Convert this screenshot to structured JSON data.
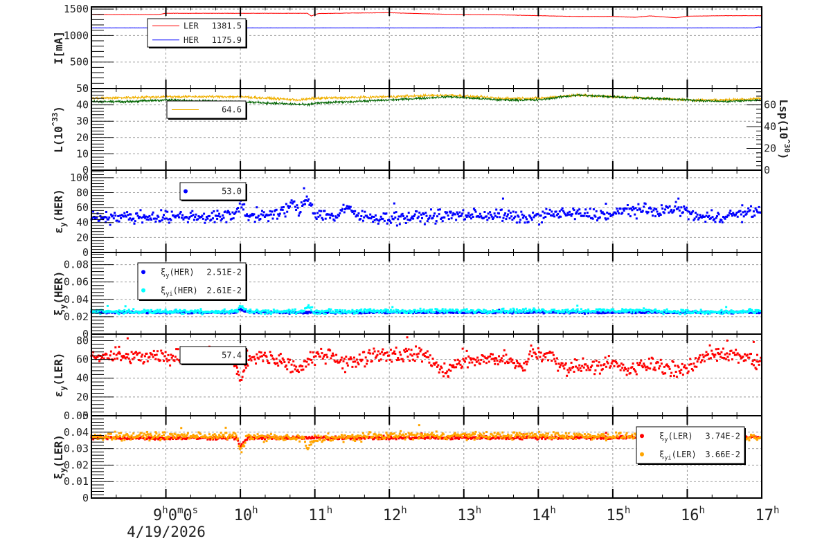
{
  "chart_data": [
    {
      "type": "line",
      "ylabel": "I[mA]",
      "ylim": [
        0,
        1540
      ],
      "yticks": [
        "0",
        "500",
        "1000",
        "1500"
      ],
      "ytick_values": [
        0,
        500,
        1000,
        1500
      ],
      "grid": true,
      "legend": {
        "placement": "top-left",
        "entries": [
          {
            "label": "LER",
            "value": "1381.5",
            "color": "#ff0000",
            "marker": "line"
          },
          {
            "label": "HER",
            "value": "1175.9",
            "color": "#0000ff",
            "marker": "line"
          }
        ]
      },
      "series": [
        {
          "name": "LER",
          "color": "#ff0000",
          "style": "line",
          "spread": 3,
          "points": [
            [
              8,
              1395
            ],
            [
              8.9,
              1395
            ],
            [
              9.0,
              1420
            ],
            [
              10,
              1420
            ],
            [
              10.9,
              1420
            ],
            [
              10.95,
              1370
            ],
            [
              11.05,
              1415
            ],
            [
              11.5,
              1425
            ],
            [
              12,
              1430
            ],
            [
              12.5,
              1410
            ],
            [
              13,
              1395
            ],
            [
              13.5,
              1390
            ],
            [
              14,
              1375
            ],
            [
              14.5,
              1360
            ],
            [
              15,
              1360
            ],
            [
              15.3,
              1345
            ],
            [
              15.5,
              1370
            ],
            [
              15.85,
              1335
            ],
            [
              16,
              1365
            ],
            [
              16.5,
              1375
            ],
            [
              17,
              1375
            ]
          ]
        },
        {
          "name": "HER",
          "color": "#0000ff",
          "style": "line",
          "spread": 2,
          "points": [
            [
              8,
              1145
            ],
            [
              9.95,
              1145
            ],
            [
              10.02,
              960
            ],
            [
              10.08,
              1145
            ],
            [
              16.9,
              1145
            ],
            [
              16.95,
              1160
            ],
            [
              17,
              1160
            ]
          ]
        }
      ]
    },
    {
      "type": "line",
      "ylabel": "L(10^33)",
      "ylim": [
        0,
        50
      ],
      "yticks": [
        "0",
        "10",
        "20",
        "30",
        "40",
        "50"
      ],
      "ytick_values": [
        0,
        10,
        20,
        30,
        40,
        50
      ],
      "y2label": "Lsp(10^30)",
      "y2lim": [
        0,
        75
      ],
      "y2ticks": [
        "0",
        "20",
        "40",
        "60"
      ],
      "y2tick_values": [
        0,
        20,
        40,
        60
      ],
      "grid": true,
      "legend": {
        "placement": "top-left",
        "entries": [
          {
            "label": "",
            "value": "64.6",
            "color": "#f0b000",
            "marker": "line"
          }
        ]
      },
      "series": [
        {
          "color": "#f0b000",
          "style": "line",
          "spread": 0.8,
          "points": [
            [
              8,
              44
            ],
            [
              9,
              45
            ],
            [
              10,
              45
            ],
            [
              10.8,
              43
            ],
            [
              11,
              44
            ],
            [
              12,
              45
            ],
            [
              12.8,
              46
            ],
            [
              13.5,
              44
            ],
            [
              14,
              44
            ],
            [
              14.5,
              46
            ],
            [
              15,
              45
            ],
            [
              15.5,
              44
            ],
            [
              16,
              43
            ],
            [
              16.5,
              43
            ],
            [
              17,
              44
            ]
          ]
        },
        {
          "color": "#006400",
          "style": "line",
          "spread": 0.7,
          "points": [
            [
              8,
              42
            ],
            [
              8.5,
              42
            ],
            [
              9,
              43
            ],
            [
              10,
              42
            ],
            [
              10.9,
              40
            ],
            [
              11,
              41
            ],
            [
              12,
              43
            ],
            [
              12.8,
              45
            ],
            [
              13.5,
              43
            ],
            [
              14,
              43
            ],
            [
              14.5,
              46
            ],
            [
              15,
              45
            ],
            [
              15.5,
              44
            ],
            [
              16,
              43
            ],
            [
              16.5,
              42
            ],
            [
              17,
              43
            ]
          ]
        }
      ]
    },
    {
      "type": "scatter",
      "ylabel": "εy(HER)",
      "ylim": [
        0,
        110
      ],
      "yticks": [
        "0",
        "20",
        "40",
        "60",
        "80",
        "100"
      ],
      "ytick_values": [
        0,
        20,
        40,
        60,
        80,
        100
      ],
      "grid": true,
      "legend": {
        "placement": "top-left",
        "entries": [
          {
            "label": "",
            "value": "53.0",
            "color": "#0000ff",
            "marker": "dot"
          }
        ]
      },
      "series": [
        {
          "color": "#0000ff",
          "style": "scatter",
          "spread": 5,
          "points": [
            [
              8,
              47
            ],
            [
              9,
              48
            ],
            [
              9.9,
              48
            ],
            [
              10,
              65
            ],
            [
              10.1,
              50
            ],
            [
              10.5,
              50
            ],
            [
              10.7,
              65
            ],
            [
              10.8,
              55
            ],
            [
              10.9,
              75
            ],
            [
              11,
              52
            ],
            [
              11.3,
              48
            ],
            [
              11.4,
              60
            ],
            [
              11.6,
              48
            ],
            [
              12,
              46
            ],
            [
              13,
              50
            ],
            [
              13.5,
              50
            ],
            [
              13.8,
              45
            ],
            [
              14.2,
              52
            ],
            [
              15,
              50
            ],
            [
              15.2,
              58
            ],
            [
              15.5,
              55
            ],
            [
              15.9,
              58
            ],
            [
              16.2,
              46
            ],
            [
              16.8,
              52
            ],
            [
              17,
              57
            ]
          ]
        }
      ]
    },
    {
      "type": "scatter",
      "ylabel": "ξy(HER)",
      "ylim": [
        0,
        0.094
      ],
      "yticks": [
        "0",
        "0.02",
        "0.04",
        "0.06",
        "0.08"
      ],
      "ytick_values": [
        0,
        0.02,
        0.04,
        0.06,
        0.08
      ],
      "grid": true,
      "legend": {
        "placement": "top-left",
        "entries": [
          {
            "label": "ξy(HER)",
            "value": "2.51E-2",
            "color": "#0000ff",
            "marker": "dot"
          },
          {
            "label": "ξyi(HER)",
            "value": "2.61E-2",
            "color": "#00ffff",
            "marker": "dot"
          }
        ]
      },
      "series": [
        {
          "name": "ξy(HER)",
          "color": "#0000ff",
          "style": "scatter",
          "spread": 0.0007,
          "points": [
            [
              8,
              0.025
            ],
            [
              9.95,
              0.025
            ],
            [
              10.0,
              0.029
            ],
            [
              10.1,
              0.025
            ],
            [
              17,
              0.025
            ]
          ]
        },
        {
          "name": "ξyi(HER)",
          "color": "#00ffff",
          "style": "scatter",
          "spread": 0.0015,
          "points": [
            [
              8,
              0.026
            ],
            [
              9.95,
              0.026
            ],
            [
              10.0,
              0.033
            ],
            [
              10.1,
              0.026
            ],
            [
              10.85,
              0.026
            ],
            [
              10.9,
              0.032
            ],
            [
              11.0,
              0.026
            ],
            [
              13.4,
              0.027
            ],
            [
              15.5,
              0.027
            ],
            [
              16.2,
              0.025
            ],
            [
              17,
              0.026
            ]
          ]
        }
      ]
    },
    {
      "type": "scatter",
      "ylabel": "εy(LER)",
      "ylim": [
        0,
        87
      ],
      "yticks": [
        "0",
        "20",
        "40",
        "60",
        "80"
      ],
      "ytick_values": [
        0,
        20,
        40,
        60,
        80
      ],
      "grid": true,
      "legend": {
        "placement": "top-left",
        "entries": [
          {
            "label": "",
            "value": "57.4",
            "color": "#ff0000",
            "marker": "none"
          }
        ]
      },
      "series": [
        {
          "color": "#ff0000",
          "style": "scatter",
          "spread": 5,
          "points": [
            [
              8,
              63
            ],
            [
              9,
              62
            ],
            [
              9.9,
              63
            ],
            [
              10,
              35
            ],
            [
              10.1,
              58
            ],
            [
              10.3,
              64
            ],
            [
              10.8,
              50
            ],
            [
              11,
              62
            ],
            [
              11.2,
              68
            ],
            [
              11.4,
              55
            ],
            [
              11.8,
              66
            ],
            [
              12.5,
              65
            ],
            [
              12.7,
              47
            ],
            [
              13,
              58
            ],
            [
              13.5,
              62
            ],
            [
              13.8,
              50
            ],
            [
              13.9,
              68
            ],
            [
              14.2,
              62
            ],
            [
              14.3,
              52
            ],
            [
              15,
              55
            ],
            [
              15.2,
              48
            ],
            [
              15.5,
              55
            ],
            [
              16,
              48
            ],
            [
              16.3,
              68
            ],
            [
              16.8,
              62
            ],
            [
              17,
              55
            ]
          ]
        }
      ]
    },
    {
      "type": "scatter",
      "ylabel": "ξy(LER)",
      "ylim": [
        0,
        0.05
      ],
      "yticks": [
        "0",
        "0.01",
        "0.02",
        "0.03",
        "0.04",
        "0.05"
      ],
      "ytick_values": [
        0,
        0.01,
        0.02,
        0.03,
        0.04,
        0.05
      ],
      "grid": true,
      "legend": {
        "placement": "bottom-right",
        "entries": [
          {
            "label": "ξy(LER)",
            "value": "3.74E-2",
            "color": "#ff0000",
            "marker": "dot"
          },
          {
            "label": "ξyi(LER)",
            "value": "3.66E-2",
            "color": "#ffa500",
            "marker": "dot"
          }
        ]
      },
      "series": [
        {
          "name": "ξy(LER)",
          "color": "#ff0000",
          "style": "scatter",
          "spread": 0.0006,
          "points": [
            [
              8,
              0.0365
            ],
            [
              9.95,
              0.0365
            ],
            [
              10.0,
              0.031
            ],
            [
              10.1,
              0.0365
            ],
            [
              17,
              0.0368
            ]
          ]
        },
        {
          "name": "ξyi(LER)",
          "color": "#ffa500",
          "style": "scatter",
          "spread": 0.0013,
          "points": [
            [
              8,
              0.0375
            ],
            [
              9.95,
              0.0378
            ],
            [
              10.0,
              0.028
            ],
            [
              10.1,
              0.0375
            ],
            [
              10.85,
              0.036
            ],
            [
              10.9,
              0.03
            ],
            [
              11.0,
              0.036
            ],
            [
              11.5,
              0.037
            ],
            [
              12,
              0.038
            ],
            [
              14,
              0.038
            ],
            [
              17,
              0.037
            ]
          ]
        }
      ]
    }
  ],
  "xaxis": {
    "range_hours": [
      8,
      17
    ],
    "ticks": [
      {
        "hour": 9,
        "label": "9",
        "sup": "h",
        "extra": "0",
        "sup2": "m",
        "extra2": "0",
        "sup3": "s"
      },
      {
        "hour": 10,
        "label": "10",
        "sup": "h"
      },
      {
        "hour": 11,
        "label": "11",
        "sup": "h"
      },
      {
        "hour": 12,
        "label": "12",
        "sup": "h"
      },
      {
        "hour": 13,
        "label": "13",
        "sup": "h"
      },
      {
        "hour": 14,
        "label": "14",
        "sup": "h"
      },
      {
        "hour": 15,
        "label": "15",
        "sup": "h"
      },
      {
        "hour": 16,
        "label": "16",
        "sup": "h"
      },
      {
        "hour": 17,
        "label": "17",
        "sup": "h"
      }
    ],
    "date": "4/19/2026"
  }
}
